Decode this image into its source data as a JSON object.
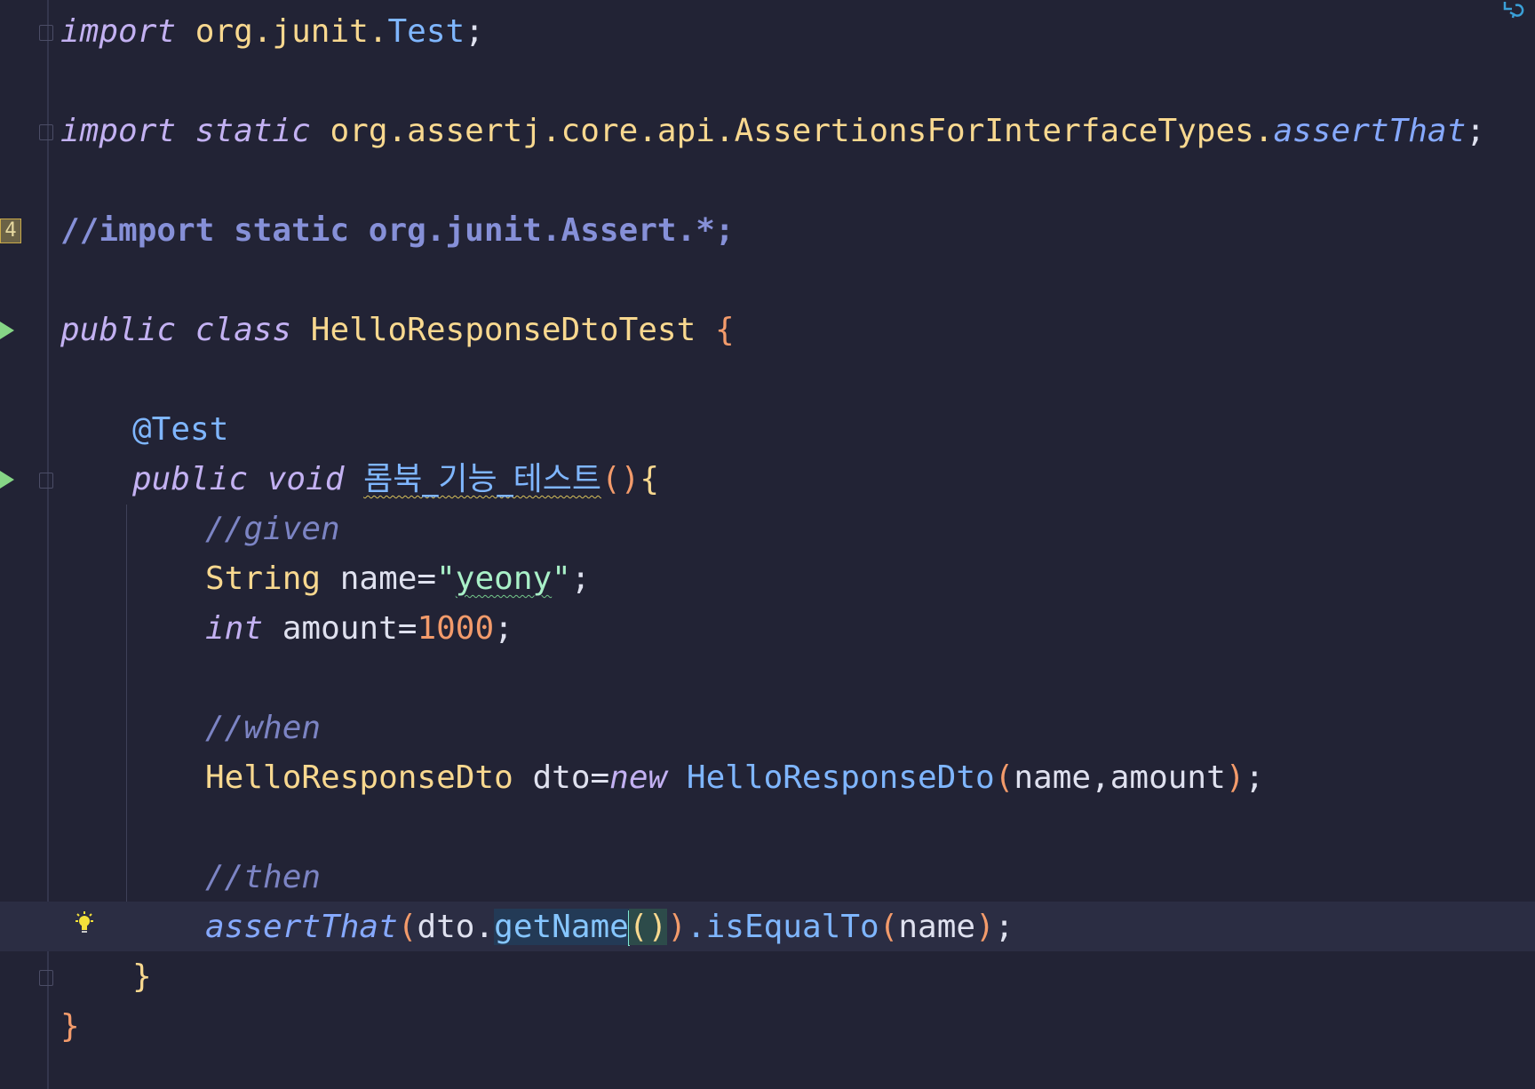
{
  "editor": {
    "language": "Java",
    "gutter": {
      "badge_value": "4"
    },
    "lines": [
      {
        "tokens": [
          "import",
          "org.junit.",
          "Test",
          ";"
        ]
      },
      {
        "tokens": [
          "import",
          "static",
          "org.assertj.core.api.AssertionsForInterfaceTypes.",
          "assertThat",
          ";"
        ]
      },
      {
        "tokens": [
          "//import static org.junit.Assert.*;"
        ]
      },
      {
        "tokens": [
          "public",
          "class",
          "HelloResponseDtoTest",
          "{"
        ]
      },
      {
        "tokens": [
          "@Test"
        ]
      },
      {
        "tokens": [
          "public",
          "void",
          "롬북_기능_테스트",
          "()",
          "{"
        ]
      },
      {
        "tokens": [
          "//given"
        ]
      },
      {
        "tokens": [
          "String",
          "name=",
          "\"",
          "yeony",
          "\"",
          ";"
        ]
      },
      {
        "tokens": [
          "int",
          "amount=",
          "1000",
          ";"
        ]
      },
      {
        "tokens": [
          "//when"
        ]
      },
      {
        "tokens": [
          "HelloResponseDto",
          "dto=",
          "new",
          "HelloResponseDto",
          "(",
          "name,amount",
          ")",
          ";"
        ]
      },
      {
        "tokens": [
          "//then"
        ]
      },
      {
        "tokens": [
          "assertThat",
          "(",
          "dto.",
          "getName",
          "(",
          ")",
          ")",
          ".isEqualTo",
          "(",
          "name",
          ")",
          ";"
        ]
      },
      {
        "tokens": [
          "}"
        ]
      },
      {
        "tokens": [
          "}"
        ]
      }
    ],
    "colors": {
      "background": "#222335",
      "current_line": "#2b2d43",
      "keyword": "#c3b1f2",
      "class_name": "#f8d88f",
      "type_ref": "#7fb6ff",
      "comment": "#7c84c4",
      "number": "#f39b6b",
      "string": "#a9f0c8"
    }
  }
}
